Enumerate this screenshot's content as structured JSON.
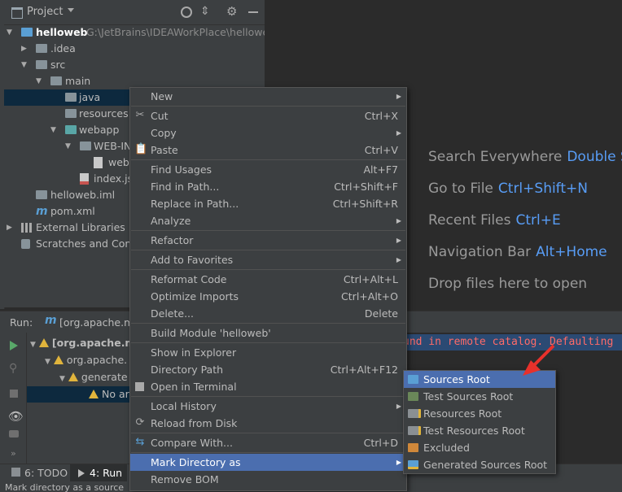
{
  "project_panel": {
    "title": "Project",
    "tree": [
      {
        "label": "helloweb",
        "path": "G:\\JetBrains\\IDEAWorkPlace\\helloweb",
        "bold": true
      },
      {
        "label": ".idea"
      },
      {
        "label": "src"
      },
      {
        "label": "main"
      },
      {
        "label": "java"
      },
      {
        "label": "resources"
      },
      {
        "label": "webapp"
      },
      {
        "label": "WEB-IN"
      },
      {
        "label": "web"
      },
      {
        "label": "index.js"
      },
      {
        "label": "helloweb.iml"
      },
      {
        "label": "pom.xml"
      },
      {
        "label": "External Libraries"
      },
      {
        "label": "Scratches and Cons"
      }
    ]
  },
  "editor_hints": [
    {
      "label": "Search Everywhere",
      "key": "Double Shi"
    },
    {
      "label": "Go to File",
      "key": "Ctrl+Shift+N"
    },
    {
      "label": "Recent Files",
      "key": "Ctrl+E"
    },
    {
      "label": "Navigation Bar",
      "key": "Alt+Home"
    },
    {
      "label": "Drop files here to open",
      "key": ""
    }
  ],
  "run_panel": {
    "label": "Run:",
    "tab": "[org.apache.m",
    "tree": [
      {
        "label": "[org.apache.m"
      },
      {
        "label": "org.apache."
      },
      {
        "label": "generate"
      },
      {
        "label": "No ar"
      }
    ],
    "console_line": "und in remote catalog. Defaulting"
  },
  "context_menu": {
    "items": [
      {
        "label": "New",
        "shortcut": "",
        "submenu": true
      },
      {
        "sep": true
      },
      {
        "label": "Cut",
        "shortcut": "Ctrl+X",
        "icon": "cut-icon"
      },
      {
        "label": "Copy",
        "shortcut": "",
        "submenu": true
      },
      {
        "label": "Paste",
        "shortcut": "Ctrl+V",
        "icon": "paste-icon"
      },
      {
        "sep": true
      },
      {
        "label": "Find Usages",
        "shortcut": "Alt+F7"
      },
      {
        "label": "Find in Path...",
        "shortcut": "Ctrl+Shift+F"
      },
      {
        "label": "Replace in Path...",
        "shortcut": "Ctrl+Shift+R"
      },
      {
        "label": "Analyze",
        "shortcut": "",
        "submenu": true
      },
      {
        "sep": true
      },
      {
        "label": "Refactor",
        "shortcut": "",
        "submenu": true
      },
      {
        "sep": true
      },
      {
        "label": "Add to Favorites",
        "shortcut": "",
        "submenu": true
      },
      {
        "sep": true
      },
      {
        "label": "Reformat Code",
        "shortcut": "Ctrl+Alt+L"
      },
      {
        "label": "Optimize Imports",
        "shortcut": "Ctrl+Alt+O"
      },
      {
        "label": "Delete...",
        "shortcut": "Delete"
      },
      {
        "sep": true
      },
      {
        "label": "Build Module 'helloweb'",
        "shortcut": ""
      },
      {
        "sep": true
      },
      {
        "label": "Show in Explorer",
        "shortcut": ""
      },
      {
        "label": "Directory Path",
        "shortcut": "Ctrl+Alt+F12"
      },
      {
        "label": "Open in Terminal",
        "shortcut": "",
        "icon": "terminal-icon"
      },
      {
        "sep": true
      },
      {
        "label": "Local History",
        "shortcut": "",
        "submenu": true
      },
      {
        "label": "Reload from Disk",
        "shortcut": "",
        "icon": "reload-icon"
      },
      {
        "sep": true
      },
      {
        "label": "Compare With...",
        "shortcut": "Ctrl+D",
        "icon": "compare-icon"
      },
      {
        "sep": true
      },
      {
        "label": "Mark Directory as",
        "shortcut": "",
        "submenu": true,
        "highlighted": true
      },
      {
        "label": "Remove BOM",
        "shortcut": ""
      }
    ]
  },
  "mark_submenu": {
    "items": [
      {
        "label": "Sources Root",
        "color": "#5a9fd4",
        "highlighted": true
      },
      {
        "label": "Test Sources Root",
        "color": "#6a8759"
      },
      {
        "label": "Resources Root",
        "color": "#8a8f93"
      },
      {
        "label": "Test Resources Root",
        "color": "#8a8f93"
      },
      {
        "label": "Excluded",
        "color": "#d0883a"
      },
      {
        "label": "Generated Sources Root",
        "color": "#5a9fd4"
      }
    ]
  },
  "tool_tabs": [
    {
      "label": "6: TODO"
    },
    {
      "label": "4: Run"
    }
  ],
  "status_bar": "Mark directory as a source"
}
